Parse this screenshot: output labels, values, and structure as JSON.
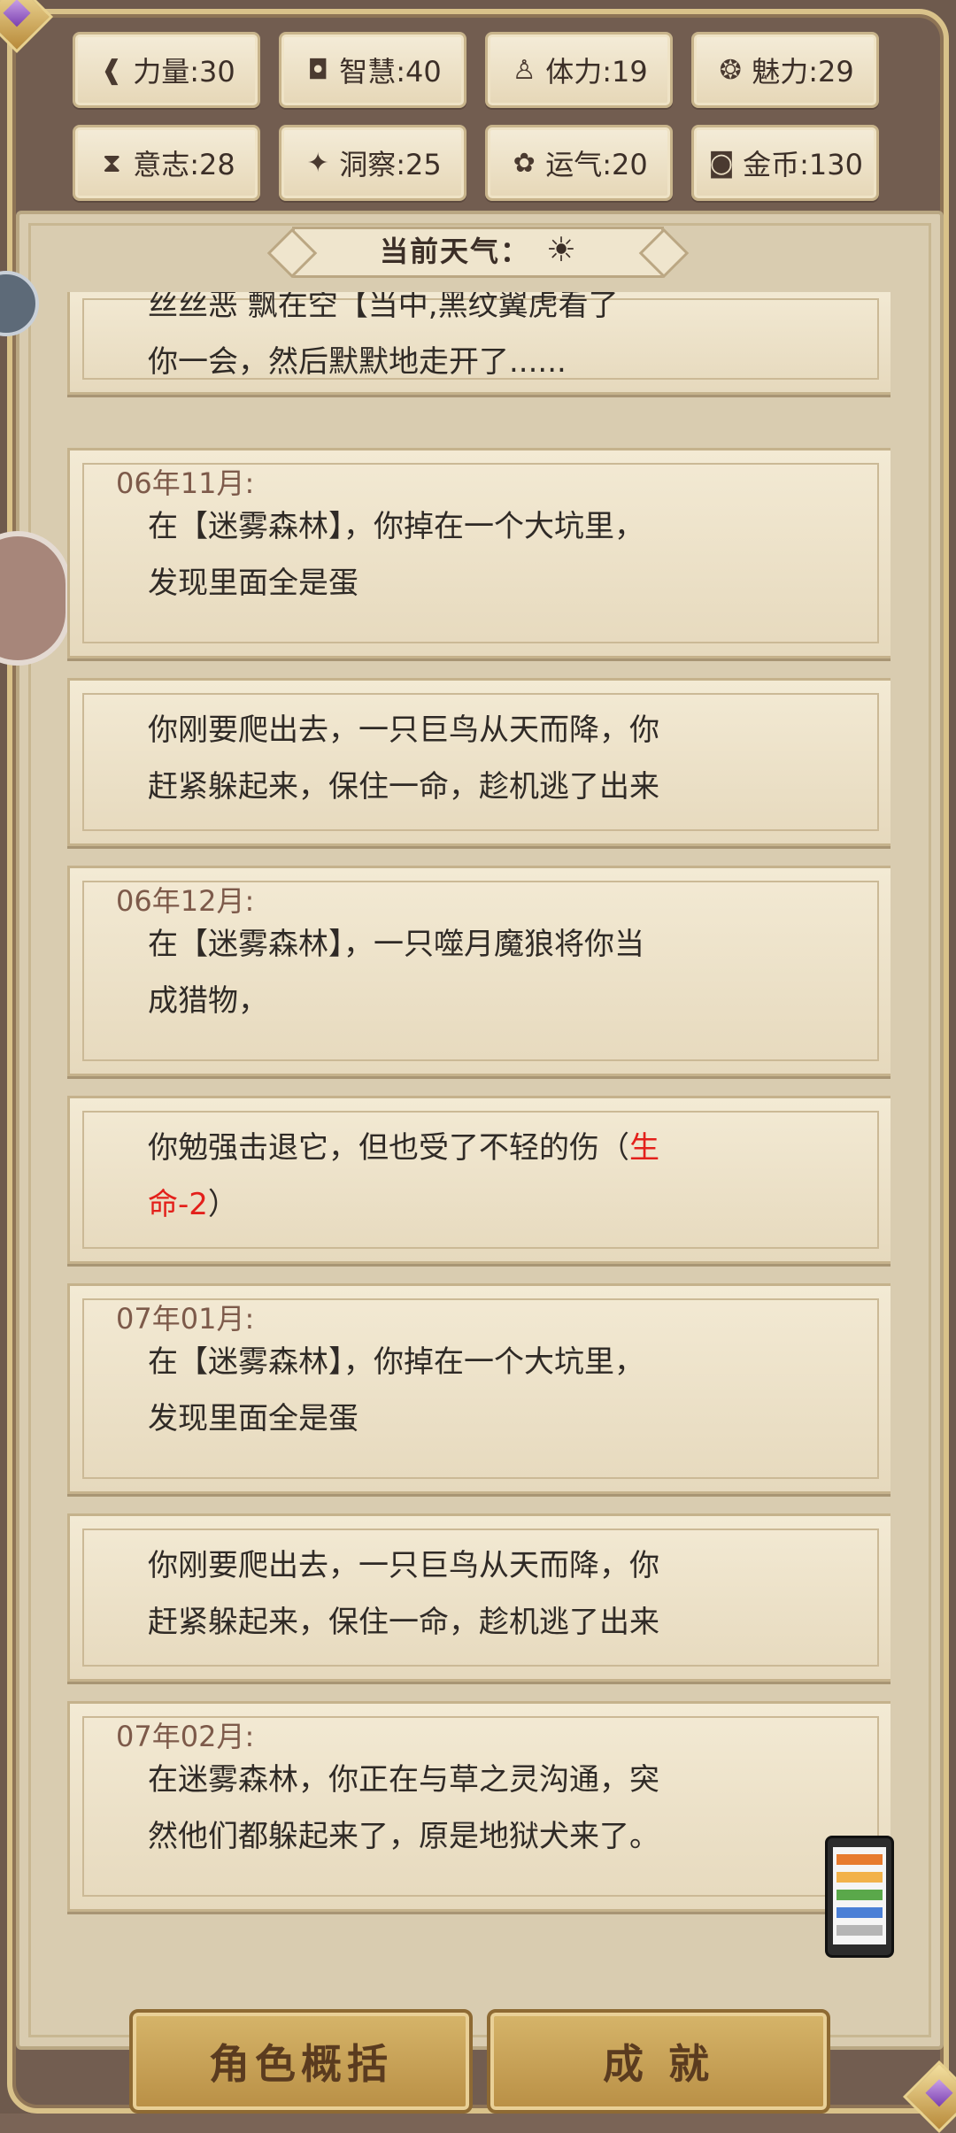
{
  "stats": [
    {
      "icon": "arm-icon",
      "glyph": "❰",
      "label": "力量:30"
    },
    {
      "icon": "book-icon",
      "glyph": "◘",
      "label": "智慧:40"
    },
    {
      "icon": "person-icon",
      "glyph": "♙",
      "label": "体力:19"
    },
    {
      "icon": "charm-icon",
      "glyph": "❂",
      "label": "魅力:29"
    },
    {
      "icon": "hourglass-icon",
      "glyph": "⧗",
      "label": "意志:28"
    },
    {
      "icon": "wolf-icon",
      "glyph": "✦",
      "label": "洞察:25"
    },
    {
      "icon": "flower-icon",
      "glyph": "✿",
      "label": "运气:20"
    },
    {
      "icon": "coin-icon",
      "glyph": "◙",
      "label": "金币:130"
    }
  ],
  "weather": {
    "label": "当前天气：",
    "icon": "sun-icon",
    "glyph": "☀"
  },
  "log": [
    {
      "date": "",
      "lines": [
        "丝丝恶 飘在空【当中,黑纹翼虎看了",
        "你一会，然后默默地走开了......"
      ],
      "partial": true
    },
    {
      "date": "06年11月:",
      "lines": [
        "在【迷雾森林】，你掉在一个大坑里，",
        "发现里面全是蛋"
      ]
    },
    {
      "date": "",
      "lines": [
        "你刚要爬出去，一只巨鸟从天而降，你",
        "赶紧躲起来，保住一命，趁机逃了出来"
      ]
    },
    {
      "date": "06年12月:",
      "lines": [
        "在【迷雾森林】，一只噬月魔狼将你当",
        "成猎物，"
      ]
    },
    {
      "date": "",
      "lines_html": true,
      "line1_a": "你勉强击退它，但也受了不轻的伤（",
      "line1_b": "生",
      "line2_a": "命-2",
      "line2_b": "）"
    },
    {
      "date": "07年01月:",
      "lines": [
        "在【迷雾森林】，你掉在一个大坑里，",
        "发现里面全是蛋"
      ]
    },
    {
      "date": "",
      "lines": [
        "你刚要爬出去，一只巨鸟从天而降，你",
        "赶紧躲起来，保住一命，趁机逃了出来"
      ]
    },
    {
      "date": "07年02月:",
      "lines": [
        "在迷雾森林，你正在与草之灵沟通，突",
        "然他们都躲起来了，原是地狱犬来了。"
      ]
    }
  ],
  "buttons": {
    "overview": "角色概括",
    "achievement": "成 就"
  },
  "colors": {
    "frame": "#725d50",
    "card": "#f3ead4",
    "date": "#7d5a4a",
    "text": "#2f2a26",
    "warning": "#e3201b",
    "button": "#c9a257"
  }
}
